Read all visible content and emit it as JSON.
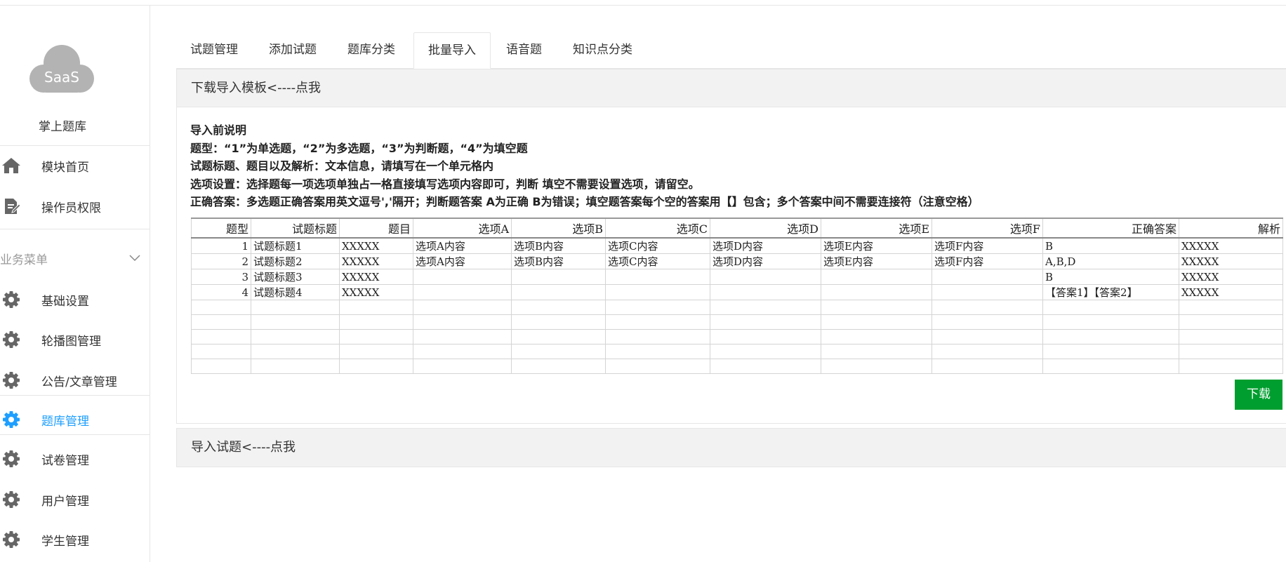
{
  "sidebar": {
    "logo_text": "SaaS",
    "brand": "掌上题库",
    "items_top": [
      {
        "label": "模块首页",
        "icon": "home-icon"
      },
      {
        "label": "操作员权限",
        "icon": "document-edit-icon"
      }
    ],
    "group_label": "业务菜单",
    "group_items": [
      {
        "label": "基础设置",
        "icon": "gear-icon"
      },
      {
        "label": "轮播图管理",
        "icon": "gear-icon"
      },
      {
        "label": "公告/文章管理",
        "icon": "gear-icon"
      },
      {
        "label": "题库管理",
        "icon": "gear-icon",
        "active": true
      },
      {
        "label": "试卷管理",
        "icon": "gear-icon"
      },
      {
        "label": "用户管理",
        "icon": "gear-icon"
      },
      {
        "label": "学生管理",
        "icon": "gear-icon"
      }
    ],
    "active_color": "#1e9fff"
  },
  "tabs": [
    {
      "label": "试题管理"
    },
    {
      "label": "添加试题"
    },
    {
      "label": "题库分类"
    },
    {
      "label": "批量导入",
      "active": true
    },
    {
      "label": "语音题"
    },
    {
      "label": "知识点分类"
    }
  ],
  "download_panel": {
    "title": "下载导入模板<----点我",
    "instructions": [
      "导入前说明",
      "题型：“1”为单选题，“2”为多选题，“3”为判断题，“4”为填空题",
      "试题标题、题目以及解析：文本信息，请填写在一个单元格内",
      "选项设置：选择题每一项选项单独占一格直接填写选项内容即可，判断 填空不需要设置选项，请留空。",
      "正确答案：多选题正确答案用英文逗号','隔开；判断题答案 A为正确 B为错误；填空题答案每个空的答案用【】包含；多个答案中间不需要连接符（注意空格）"
    ],
    "table": {
      "headers": [
        "题型",
        "试题标题",
        "题目",
        "选项A",
        "选项B",
        "选项C",
        "选项D",
        "选项E",
        "选项F",
        "正确答案",
        "解析"
      ],
      "rows": [
        [
          "1",
          "试题标题1",
          "XXXXX",
          "选项A内容",
          "选项B内容",
          "选项C内容",
          "选项D内容",
          "选项E内容",
          "选项F内容",
          "B",
          "XXXXX"
        ],
        [
          "2",
          "试题标题2",
          "XXXXX",
          "选项A内容",
          "选项B内容",
          "选项C内容",
          "选项D内容",
          "选项E内容",
          "选项F内容",
          "A,B,D",
          "XXXXX"
        ],
        [
          "3",
          "试题标题3",
          "XXXXX",
          "",
          "",
          "",
          "",
          "",
          "",
          "B",
          "XXXXX"
        ],
        [
          "4",
          "试题标题4",
          "XXXXX",
          "",
          "",
          "",
          "",
          "",
          "",
          "【答案1】【答案2】",
          "XXXXX"
        ]
      ],
      "empty_rows": 5
    },
    "download_button": "下载",
    "button_color": "#009e2f"
  },
  "import_panel": {
    "title": "导入试题<----点我"
  }
}
